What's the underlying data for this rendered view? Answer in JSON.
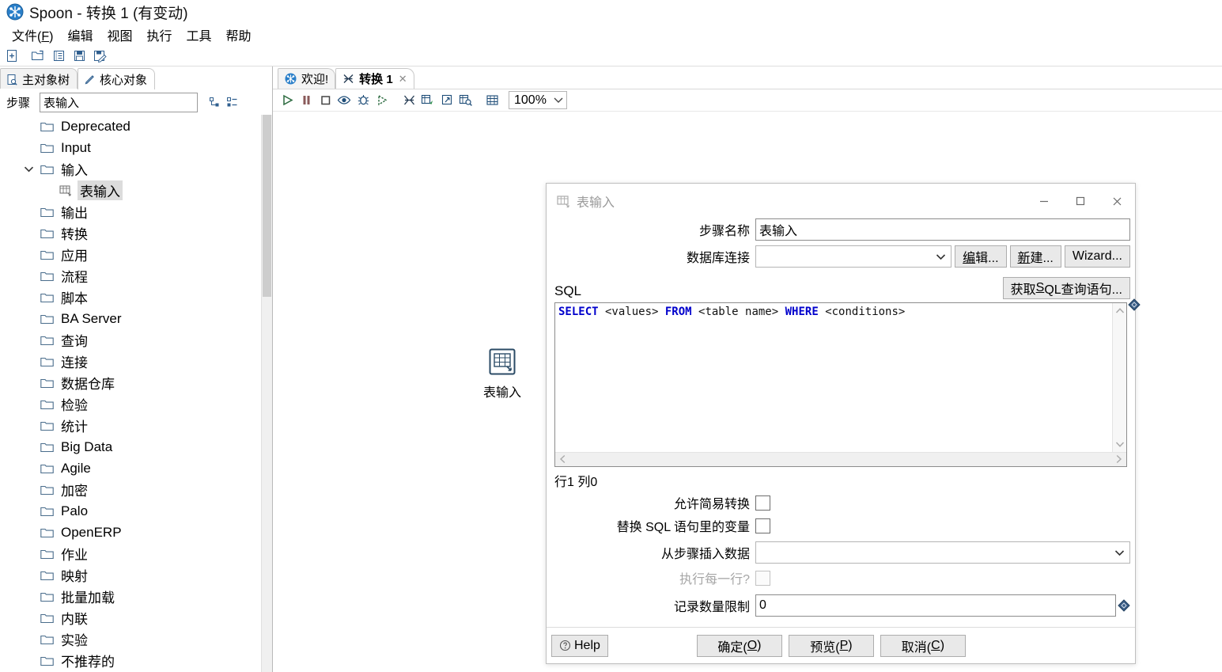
{
  "window": {
    "app_icon": "spoon-logo-icon",
    "title": "Spoon - 转换 1 (有变动)"
  },
  "menubar": {
    "items": [
      {
        "label": "文件(F)",
        "mnemonic": "F"
      },
      {
        "label": "编辑",
        "mnemonic": ""
      },
      {
        "label": "视图",
        "mnemonic": ""
      },
      {
        "label": "执行",
        "mnemonic": ""
      },
      {
        "label": "工具",
        "mnemonic": ""
      },
      {
        "label": "帮助",
        "mnemonic": ""
      }
    ]
  },
  "toolbar": {
    "buttons": [
      {
        "icon": "new-file-icon",
        "name": "new-transformation-button"
      },
      {
        "icon": "open-folder-icon",
        "name": "open-file-button"
      },
      {
        "icon": "repository-explore-icon",
        "name": "explore-repository-button"
      },
      {
        "icon": "save-icon",
        "name": "save-button"
      },
      {
        "icon": "save-as-icon",
        "name": "save-as-button"
      }
    ]
  },
  "left_panel": {
    "tabs": [
      {
        "label": "主对象树",
        "icon": "document-tree-icon",
        "active": false
      },
      {
        "label": "核心对象",
        "icon": "pencil-icon",
        "active": true
      }
    ],
    "filter": {
      "label": "步骤",
      "value": "表输入",
      "placeholder": ""
    },
    "tree_tools": [
      {
        "icon": "expand-tree-icon",
        "name": "expand-all-button"
      },
      {
        "icon": "collapse-tree-icon",
        "name": "collapse-all-button"
      }
    ],
    "tree": [
      {
        "label": "Deprecated",
        "depth": 1,
        "icon": "folder-icon",
        "expanded": null,
        "selected": false
      },
      {
        "label": "Input",
        "depth": 1,
        "icon": "folder-icon",
        "expanded": null,
        "selected": false
      },
      {
        "label": "输入",
        "depth": 1,
        "icon": "folder-icon",
        "expanded": true,
        "selected": false
      },
      {
        "label": "表输入",
        "depth": 2,
        "icon": "table-input-icon",
        "expanded": null,
        "selected": true
      },
      {
        "label": "输出",
        "depth": 1,
        "icon": "folder-icon",
        "expanded": null,
        "selected": false
      },
      {
        "label": "转换",
        "depth": 1,
        "icon": "folder-icon",
        "expanded": null,
        "selected": false
      },
      {
        "label": "应用",
        "depth": 1,
        "icon": "folder-icon",
        "expanded": null,
        "selected": false
      },
      {
        "label": "流程",
        "depth": 1,
        "icon": "folder-icon",
        "expanded": null,
        "selected": false
      },
      {
        "label": "脚本",
        "depth": 1,
        "icon": "folder-icon",
        "expanded": null,
        "selected": false
      },
      {
        "label": "BA Server",
        "depth": 1,
        "icon": "folder-icon",
        "expanded": null,
        "selected": false
      },
      {
        "label": "查询",
        "depth": 1,
        "icon": "folder-icon",
        "expanded": null,
        "selected": false
      },
      {
        "label": "连接",
        "depth": 1,
        "icon": "folder-icon",
        "expanded": null,
        "selected": false
      },
      {
        "label": "数据仓库",
        "depth": 1,
        "icon": "folder-icon",
        "expanded": null,
        "selected": false
      },
      {
        "label": "检验",
        "depth": 1,
        "icon": "folder-icon",
        "expanded": null,
        "selected": false
      },
      {
        "label": "统计",
        "depth": 1,
        "icon": "folder-icon",
        "expanded": null,
        "selected": false
      },
      {
        "label": "Big Data",
        "depth": 1,
        "icon": "folder-icon",
        "expanded": null,
        "selected": false
      },
      {
        "label": "Agile",
        "depth": 1,
        "icon": "folder-icon",
        "expanded": null,
        "selected": false
      },
      {
        "label": "加密",
        "depth": 1,
        "icon": "folder-icon",
        "expanded": null,
        "selected": false
      },
      {
        "label": "Palo",
        "depth": 1,
        "icon": "folder-icon",
        "expanded": null,
        "selected": false
      },
      {
        "label": "OpenERP",
        "depth": 1,
        "icon": "folder-icon",
        "expanded": null,
        "selected": false
      },
      {
        "label": "作业",
        "depth": 1,
        "icon": "folder-icon",
        "expanded": null,
        "selected": false
      },
      {
        "label": "映射",
        "depth": 1,
        "icon": "folder-icon",
        "expanded": null,
        "selected": false
      },
      {
        "label": "批量加载",
        "depth": 1,
        "icon": "folder-icon",
        "expanded": null,
        "selected": false
      },
      {
        "label": "内联",
        "depth": 1,
        "icon": "folder-icon",
        "expanded": null,
        "selected": false
      },
      {
        "label": "实验",
        "depth": 1,
        "icon": "folder-icon",
        "expanded": null,
        "selected": false
      },
      {
        "label": "不推荐的",
        "depth": 1,
        "icon": "folder-icon",
        "expanded": null,
        "selected": false
      }
    ]
  },
  "canvas": {
    "tabs": [
      {
        "label": "欢迎!",
        "icon": "spoon-logo-icon",
        "active": false,
        "closable": false
      },
      {
        "label": "转换 1",
        "icon": "transformation-icon",
        "active": true,
        "closable": true,
        "close_label": "✕"
      }
    ],
    "toolbar": [
      {
        "icon": "run-icon",
        "name": "run-button"
      },
      {
        "icon": "pause-icon",
        "name": "pause-button"
      },
      {
        "icon": "stop-icon",
        "name": "stop-button"
      },
      {
        "icon": "preview-eye-icon",
        "name": "preview-button"
      },
      {
        "icon": "debug-bug-icon",
        "name": "debug-button"
      },
      {
        "icon": "replay-icon",
        "name": "replay-button"
      },
      {
        "icon": "transformation-settings-icon",
        "name": "transformation-settings-button"
      },
      {
        "icon": "show-grid-icon",
        "name": "show-results-button"
      },
      {
        "icon": "hop-icon",
        "name": "hop-button"
      },
      {
        "icon": "search-grid-icon",
        "name": "inspect-data-button"
      },
      {
        "icon": "align-grid-icon",
        "name": "arrange-steps-button"
      }
    ],
    "zoom": "100%",
    "step": {
      "label": "表输入",
      "icon": "table-input-icon"
    }
  },
  "dialog": {
    "icon": "table-input-icon",
    "title": "表输入",
    "window_buttons": {
      "minimize": "minimize-icon",
      "maximize": "maximize-icon",
      "close": "close-icon"
    },
    "step_name": {
      "label": "步骤名称",
      "value": "表输入"
    },
    "connection": {
      "label": "数据库连接",
      "value": "",
      "buttons": [
        {
          "label": "编辑...",
          "mnemonic": "编",
          "name": "edit-connection-button"
        },
        {
          "label": "新建...",
          "mnemonic": "新",
          "name": "new-connection-button"
        },
        {
          "label": "Wizard...",
          "mnemonic": "W",
          "name": "connection-wizard-button"
        }
      ]
    },
    "sql": {
      "label": "SQL",
      "get_sql_button": "获取SQL查询语句...",
      "tokens": [
        {
          "text": "SELECT",
          "kind": "keyword"
        },
        {
          "text": " <values> ",
          "kind": "plain"
        },
        {
          "text": "FROM",
          "kind": "keyword"
        },
        {
          "text": " <table name> ",
          "kind": "plain"
        },
        {
          "text": "WHERE",
          "kind": "keyword"
        },
        {
          "text": " <conditions>",
          "kind": "plain"
        }
      ],
      "raw": "SELECT <values> FROM <table name> WHERE <conditions>"
    },
    "position_status": "行1 列0",
    "checkboxes": [
      {
        "label": "允许简易转换",
        "checked": false,
        "disabled": false,
        "name": "allow-lazy-conversion-checkbox"
      },
      {
        "label": "替换 SQL 语句里的变量",
        "checked": false,
        "disabled": false,
        "name": "replace-variables-checkbox"
      }
    ],
    "insert_from_step": {
      "label": "从步骤插入数据",
      "value": ""
    },
    "execute_each_row": {
      "label": "执行每一行?",
      "checked": false,
      "disabled": true
    },
    "row_limit": {
      "label": "记录数量限制",
      "value": "0"
    },
    "footer": {
      "help": "Help",
      "help_icon": "help-circle-icon",
      "ok": "确定(O)",
      "ok_mnemonic": "O",
      "preview": "预览(P)",
      "preview_mnemonic": "P",
      "cancel": "取消(C)",
      "cancel_mnemonic": "C"
    }
  },
  "colors": {
    "accent_blue": "#1f7fd0",
    "keyword_blue": "#0000cc",
    "selection_gray": "#dcdcdc",
    "panel_border": "#b9b9b9"
  }
}
